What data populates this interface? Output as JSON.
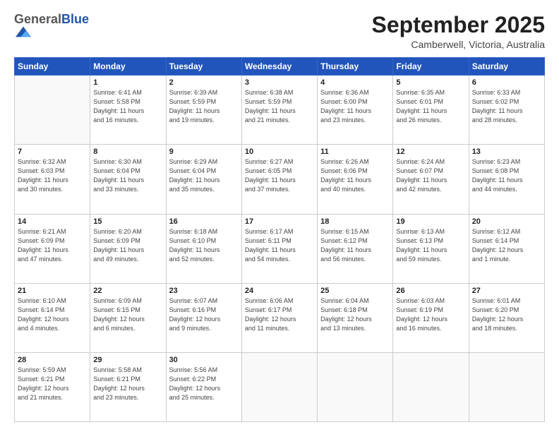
{
  "logo": {
    "general": "General",
    "blue": "Blue"
  },
  "header": {
    "month": "September 2025",
    "location": "Camberwell, Victoria, Australia"
  },
  "weekdays": [
    "Sunday",
    "Monday",
    "Tuesday",
    "Wednesday",
    "Thursday",
    "Friday",
    "Saturday"
  ],
  "weeks": [
    [
      {
        "day": "",
        "info": ""
      },
      {
        "day": "1",
        "info": "Sunrise: 6:41 AM\nSunset: 5:58 PM\nDaylight: 11 hours\nand 16 minutes."
      },
      {
        "day": "2",
        "info": "Sunrise: 6:39 AM\nSunset: 5:59 PM\nDaylight: 11 hours\nand 19 minutes."
      },
      {
        "day": "3",
        "info": "Sunrise: 6:38 AM\nSunset: 5:59 PM\nDaylight: 11 hours\nand 21 minutes."
      },
      {
        "day": "4",
        "info": "Sunrise: 6:36 AM\nSunset: 6:00 PM\nDaylight: 11 hours\nand 23 minutes."
      },
      {
        "day": "5",
        "info": "Sunrise: 6:35 AM\nSunset: 6:01 PM\nDaylight: 11 hours\nand 26 minutes."
      },
      {
        "day": "6",
        "info": "Sunrise: 6:33 AM\nSunset: 6:02 PM\nDaylight: 11 hours\nand 28 minutes."
      }
    ],
    [
      {
        "day": "7",
        "info": "Sunrise: 6:32 AM\nSunset: 6:03 PM\nDaylight: 11 hours\nand 30 minutes."
      },
      {
        "day": "8",
        "info": "Sunrise: 6:30 AM\nSunset: 6:04 PM\nDaylight: 11 hours\nand 33 minutes."
      },
      {
        "day": "9",
        "info": "Sunrise: 6:29 AM\nSunset: 6:04 PM\nDaylight: 11 hours\nand 35 minutes."
      },
      {
        "day": "10",
        "info": "Sunrise: 6:27 AM\nSunset: 6:05 PM\nDaylight: 11 hours\nand 37 minutes."
      },
      {
        "day": "11",
        "info": "Sunrise: 6:26 AM\nSunset: 6:06 PM\nDaylight: 11 hours\nand 40 minutes."
      },
      {
        "day": "12",
        "info": "Sunrise: 6:24 AM\nSunset: 6:07 PM\nDaylight: 11 hours\nand 42 minutes."
      },
      {
        "day": "13",
        "info": "Sunrise: 6:23 AM\nSunset: 6:08 PM\nDaylight: 11 hours\nand 44 minutes."
      }
    ],
    [
      {
        "day": "14",
        "info": "Sunrise: 6:21 AM\nSunset: 6:09 PM\nDaylight: 11 hours\nand 47 minutes."
      },
      {
        "day": "15",
        "info": "Sunrise: 6:20 AM\nSunset: 6:09 PM\nDaylight: 11 hours\nand 49 minutes."
      },
      {
        "day": "16",
        "info": "Sunrise: 6:18 AM\nSunset: 6:10 PM\nDaylight: 11 hours\nand 52 minutes."
      },
      {
        "day": "17",
        "info": "Sunrise: 6:17 AM\nSunset: 6:11 PM\nDaylight: 11 hours\nand 54 minutes."
      },
      {
        "day": "18",
        "info": "Sunrise: 6:15 AM\nSunset: 6:12 PM\nDaylight: 11 hours\nand 56 minutes."
      },
      {
        "day": "19",
        "info": "Sunrise: 6:13 AM\nSunset: 6:13 PM\nDaylight: 11 hours\nand 59 minutes."
      },
      {
        "day": "20",
        "info": "Sunrise: 6:12 AM\nSunset: 6:14 PM\nDaylight: 12 hours\nand 1 minute."
      }
    ],
    [
      {
        "day": "21",
        "info": "Sunrise: 6:10 AM\nSunset: 6:14 PM\nDaylight: 12 hours\nand 4 minutes."
      },
      {
        "day": "22",
        "info": "Sunrise: 6:09 AM\nSunset: 6:15 PM\nDaylight: 12 hours\nand 6 minutes."
      },
      {
        "day": "23",
        "info": "Sunrise: 6:07 AM\nSunset: 6:16 PM\nDaylight: 12 hours\nand 9 minutes."
      },
      {
        "day": "24",
        "info": "Sunrise: 6:06 AM\nSunset: 6:17 PM\nDaylight: 12 hours\nand 11 minutes."
      },
      {
        "day": "25",
        "info": "Sunrise: 6:04 AM\nSunset: 6:18 PM\nDaylight: 12 hours\nand 13 minutes."
      },
      {
        "day": "26",
        "info": "Sunrise: 6:03 AM\nSunset: 6:19 PM\nDaylight: 12 hours\nand 16 minutes."
      },
      {
        "day": "27",
        "info": "Sunrise: 6:01 AM\nSunset: 6:20 PM\nDaylight: 12 hours\nand 18 minutes."
      }
    ],
    [
      {
        "day": "28",
        "info": "Sunrise: 5:59 AM\nSunset: 6:21 PM\nDaylight: 12 hours\nand 21 minutes."
      },
      {
        "day": "29",
        "info": "Sunrise: 5:58 AM\nSunset: 6:21 PM\nDaylight: 12 hours\nand 23 minutes."
      },
      {
        "day": "30",
        "info": "Sunrise: 5:56 AM\nSunset: 6:22 PM\nDaylight: 12 hours\nand 25 minutes."
      },
      {
        "day": "",
        "info": ""
      },
      {
        "day": "",
        "info": ""
      },
      {
        "day": "",
        "info": ""
      },
      {
        "day": "",
        "info": ""
      }
    ]
  ]
}
